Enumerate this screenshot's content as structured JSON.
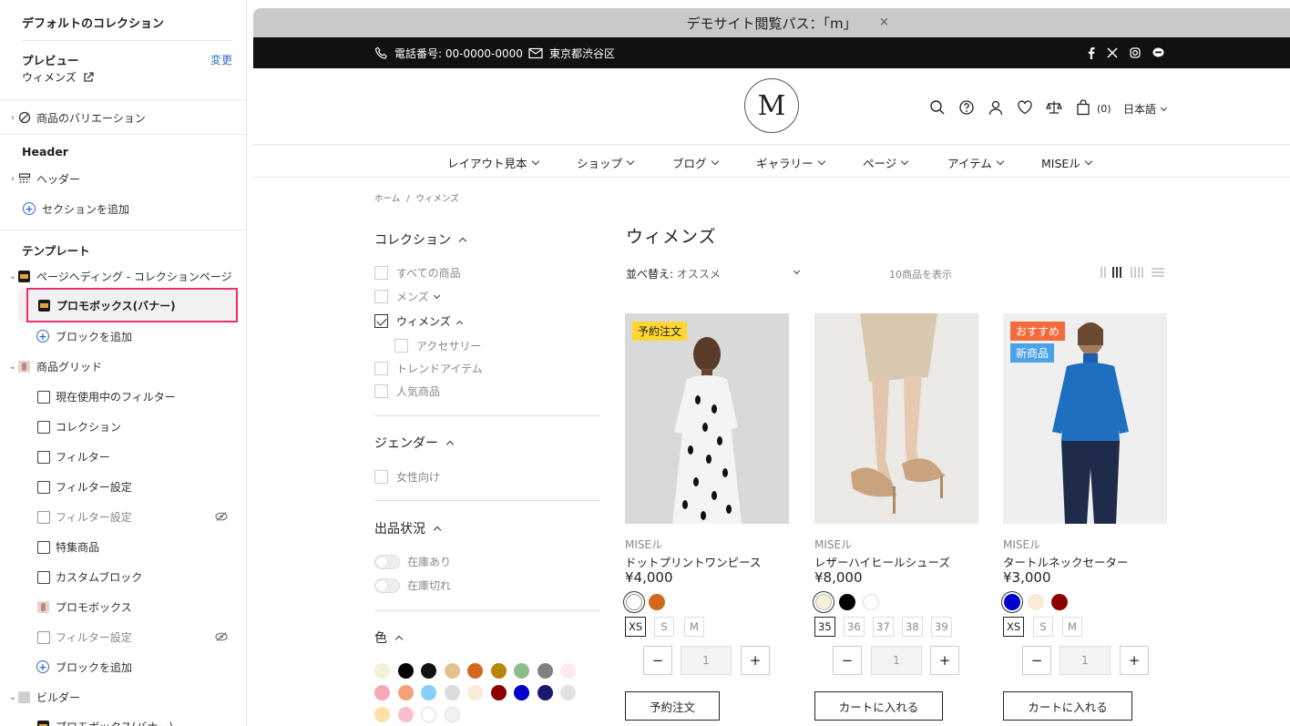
{
  "sidebar": {
    "title": "デフォルトのコレクション",
    "preview_label": "プレビュー",
    "change_label": "変更",
    "preview_value": "ウィメンズ",
    "variations_label": "商品のバリエーション",
    "header_section": "Header",
    "header_item": "ヘッダー",
    "add_section": "セクションを追加",
    "template_section": "テンプレート",
    "page_heading": "ページヘディング - コレクションページ",
    "promo_banner": "プロモボックス(バナー)",
    "add_block": "ブロックを追加",
    "product_grid": "商品グリッド",
    "blocks": [
      "現在使用中のフィルター",
      "コレクション",
      "フィルター",
      "フィルター設定",
      "フィルター設定",
      "特集商品",
      "カスタムブロック",
      "プロモボックス",
      "フィルター設定"
    ],
    "add_block_2": "ブロックを追加",
    "builder": "ビルダー",
    "builder_child": "プロモボックス(バナー)"
  },
  "demo_bar": {
    "text": "デモサイト閲覧パス：「m」",
    "close": "×"
  },
  "topbar": {
    "phone": "電話番号: 00-0000-0000",
    "address": "東京都渋谷区",
    "social_icons": [
      "facebook-icon",
      "x-icon",
      "instagram-icon",
      "line-icon"
    ]
  },
  "header": {
    "logo": "M",
    "cart_count": "(0)",
    "language": "日本語"
  },
  "nav": [
    "レイアウト見本",
    "ショップ",
    "ブログ",
    "ギャラリー",
    "ページ",
    "アイテム",
    "MISEル"
  ],
  "breadcrumb": {
    "home": "ホーム",
    "sep": "/",
    "current": "ウィメンズ"
  },
  "filters": {
    "collection": {
      "title": "コレクション",
      "items": [
        "すべての商品",
        "メンズ",
        "ウィメンズ",
        "アクセサリー",
        "トレンドアイテム",
        "人気商品"
      ]
    },
    "gender": {
      "title": "ジェンダー",
      "items": [
        "女性向け"
      ]
    },
    "stock": {
      "title": "出品状況",
      "items": [
        "在庫あり",
        "在庫切れ"
      ]
    },
    "color": {
      "title": "色",
      "swatches": [
        "#f4f1d8",
        "#000000",
        "#111111",
        "#e3c08e",
        "#d2691e",
        "#b8860b",
        "#8fbc8f",
        "#808080",
        "#fde8ee",
        "#f7a8b8",
        "#f4a07a",
        "#87cefa",
        "#dcdcdc",
        "#faebd7",
        "#8b0000",
        "#0000cd",
        "#191970",
        "#e0e0e0",
        "#fce0a8",
        "#f8c0cc",
        "#ffffff",
        "#f2f2f2"
      ]
    }
  },
  "products_header": {
    "title": "ウィメンズ",
    "sort_label": "並べ替え:",
    "sort_value": "オススメ",
    "count": "10商品を表示"
  },
  "products": [
    {
      "badges": [
        "予約注文"
      ],
      "brand": "MISEル",
      "name": "ドットプリントワンピース",
      "price": "¥4,000",
      "colors": [
        "#ffffff",
        "#d2691e"
      ],
      "sizes": [
        "XS",
        "S",
        "M"
      ],
      "qty": "1",
      "minus": "−",
      "plus": "+",
      "button": "予約注文"
    },
    {
      "badges": [],
      "brand": "MISEル",
      "name": "レザーハイヒールシューズ",
      "price": "¥8,000",
      "colors": [
        "#f4f1d8",
        "#000000",
        "#ffffff"
      ],
      "sizes": [
        "35",
        "36",
        "37",
        "38",
        "39"
      ],
      "qty": "1",
      "minus": "−",
      "plus": "+",
      "button": "カートに入れる"
    },
    {
      "badges": [
        "おすすめ",
        "新商品"
      ],
      "brand": "MISEル",
      "name": "タートルネックセーター",
      "price": "¥3,000",
      "colors": [
        "#0000cd",
        "#faebd7",
        "#8b0000"
      ],
      "sizes": [
        "XS",
        "S",
        "M"
      ],
      "qty": "1",
      "minus": "−",
      "plus": "+",
      "button": "カートに入れる"
    }
  ],
  "colors": {
    "highlight": "#e8316a",
    "link": "#2c6ecb",
    "badge_preorder": "#ffd633",
    "badge_recommend": "#f26b3a",
    "badge_new": "#4aa3e8"
  }
}
